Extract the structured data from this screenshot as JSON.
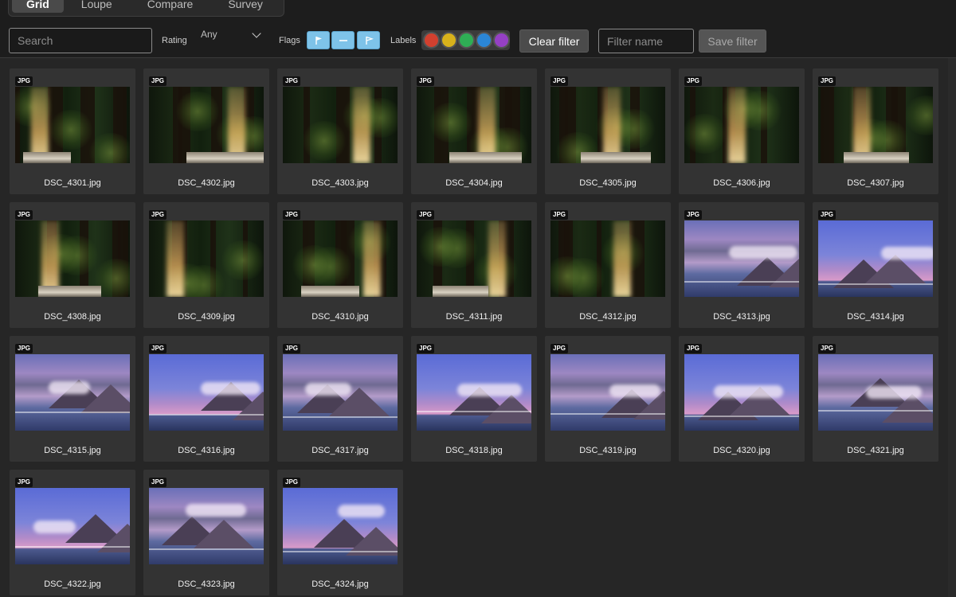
{
  "tabs": [
    {
      "label": "Grid",
      "active": true
    },
    {
      "label": "Loupe",
      "active": false
    },
    {
      "label": "Compare",
      "active": false
    },
    {
      "label": "Survey",
      "active": false
    }
  ],
  "filters": {
    "search_placeholder": "Search",
    "rating_label": "Rating",
    "rating_value": "Any",
    "flags_label": "Flags",
    "flags": [
      "flag-icon",
      "dash-icon",
      "flag-outline-icon"
    ],
    "labels_label": "Labels",
    "label_colors": [
      "#d2402f",
      "#d8b21b",
      "#2fae55",
      "#2b86d6",
      "#9540c4"
    ],
    "clear_label": "Clear filter",
    "filter_name_placeholder": "Filter name",
    "save_label": "Save filter"
  },
  "photos": [
    {
      "name": "DSC_4301.jpg",
      "badge": "JPG",
      "kind": "forest"
    },
    {
      "name": "DSC_4302.jpg",
      "badge": "JPG",
      "kind": "forest"
    },
    {
      "name": "DSC_4303.jpg",
      "badge": "JPG",
      "kind": "forest"
    },
    {
      "name": "DSC_4304.jpg",
      "badge": "JPG",
      "kind": "forest"
    },
    {
      "name": "DSC_4305.jpg",
      "badge": "JPG",
      "kind": "forest"
    },
    {
      "name": "DSC_4306.jpg",
      "badge": "JPG",
      "kind": "forest"
    },
    {
      "name": "DSC_4307.jpg",
      "badge": "JPG",
      "kind": "forest"
    },
    {
      "name": "DSC_4308.jpg",
      "badge": "JPG",
      "kind": "forest"
    },
    {
      "name": "DSC_4309.jpg",
      "badge": "JPG",
      "kind": "forest"
    },
    {
      "name": "DSC_4310.jpg",
      "badge": "JPG",
      "kind": "forest"
    },
    {
      "name": "DSC_4311.jpg",
      "badge": "JPG",
      "kind": "forest"
    },
    {
      "name": "DSC_4312.jpg",
      "badge": "JPG",
      "kind": "forest"
    },
    {
      "name": "DSC_4313.jpg",
      "badge": "JPG",
      "kind": "landscape"
    },
    {
      "name": "DSC_4314.jpg",
      "badge": "JPG",
      "kind": "landscape"
    },
    {
      "name": "DSC_4315.jpg",
      "badge": "JPG",
      "kind": "landscape"
    },
    {
      "name": "DSC_4316.jpg",
      "badge": "JPG",
      "kind": "landscape"
    },
    {
      "name": "DSC_4317.jpg",
      "badge": "JPG",
      "kind": "landscape"
    },
    {
      "name": "DSC_4318.jpg",
      "badge": "JPG",
      "kind": "landscape"
    },
    {
      "name": "DSC_4319.jpg",
      "badge": "JPG",
      "kind": "landscape"
    },
    {
      "name": "DSC_4320.jpg",
      "badge": "JPG",
      "kind": "landscape"
    },
    {
      "name": "DSC_4321.jpg",
      "badge": "JPG",
      "kind": "landscape"
    },
    {
      "name": "DSC_4322.jpg",
      "badge": "JPG",
      "kind": "landscape"
    },
    {
      "name": "DSC_4323.jpg",
      "badge": "JPG",
      "kind": "landscape"
    },
    {
      "name": "DSC_4324.jpg",
      "badge": "JPG",
      "kind": "landscape"
    }
  ]
}
